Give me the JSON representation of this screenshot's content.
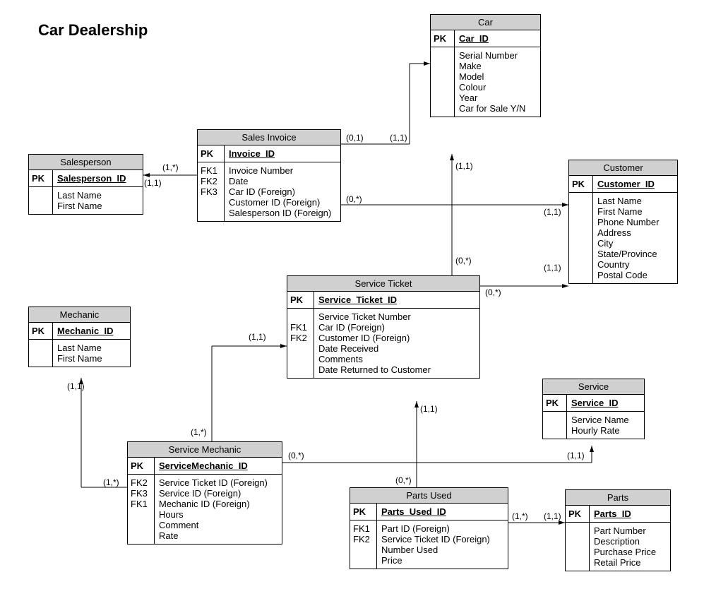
{
  "title": "Car Dealership",
  "entities": {
    "salesperson": {
      "name": "Salesperson",
      "pk_key": "PK",
      "pk_val": "Salesperson_ID",
      "fkeys": [],
      "attrs": [
        "Last Name",
        "First Name"
      ]
    },
    "salesinvoice": {
      "name": "Sales Invoice",
      "pk_key": "PK",
      "pk_val": "Invoice_ID",
      "fkeys": [
        "",
        "",
        "FK1",
        "FK2",
        "FK3"
      ],
      "attrs": [
        "Invoice Number",
        "Date",
        "Car ID (Foreign)",
        "Customer ID (Foreign)",
        "Salesperson ID (Foreign)"
      ]
    },
    "car": {
      "name": "Car",
      "pk_key": "PK",
      "pk_val": "Car_ID",
      "fkeys": [],
      "attrs": [
        "Serial Number",
        "Make",
        "Model",
        "Colour",
        "Year",
        "Car for Sale Y/N"
      ]
    },
    "customer": {
      "name": "Customer",
      "pk_key": "PK",
      "pk_val": "Customer_ID",
      "fkeys": [],
      "attrs": [
        "Last Name",
        "First Name",
        "Phone Number",
        "Address",
        "City",
        "State/Province",
        "Country",
        "Postal Code"
      ]
    },
    "mechanic": {
      "name": "Mechanic",
      "pk_key": "PK",
      "pk_val": "Mechanic_ID",
      "fkeys": [],
      "attrs": [
        "Last Name",
        "First Name"
      ]
    },
    "serviceticket": {
      "name": "Service Ticket",
      "pk_key": "PK",
      "pk_val": "Service_Ticket_ID",
      "fkeys": [
        "",
        "FK1",
        "FK2",
        "",
        "",
        ""
      ],
      "attrs": [
        "Service Ticket Number",
        "Car ID (Foreign)",
        "Customer ID (Foreign)",
        "Date Received",
        "Comments",
        "Date Returned to Customer"
      ]
    },
    "service": {
      "name": "Service",
      "pk_key": "PK",
      "pk_val": "Service_ID",
      "fkeys": [],
      "attrs": [
        "Service Name",
        "Hourly Rate"
      ]
    },
    "servicemechanic": {
      "name": "Service Mechanic",
      "pk_key": "PK",
      "pk_val": "ServiceMechanic_ID",
      "fkeys": [
        "FK2",
        "FK3",
        "FK1",
        "",
        "",
        ""
      ],
      "attrs": [
        "Service Ticket ID (Foreign)",
        "Service ID (Foreign)",
        "Mechanic ID (Foreign)",
        "Hours",
        "Comment",
        "Rate"
      ]
    },
    "partsused": {
      "name": "Parts Used",
      "pk_key": "PK",
      "pk_val": "Parts_Used_ID",
      "fkeys": [
        "FK1",
        "FK2",
        "",
        ""
      ],
      "attrs": [
        "Part ID (Foreign)",
        "Service Ticket ID (Foreign)",
        "Number Used",
        "Price"
      ]
    },
    "parts": {
      "name": "Parts",
      "pk_key": "PK",
      "pk_val": "Parts_ID",
      "fkeys": [],
      "attrs": [
        "Part Number",
        "Description",
        "Purchase Price",
        "Retail Price"
      ]
    }
  },
  "cards": {
    "si_sp_a": "(1,*)",
    "si_sp_b": "(1,1)",
    "si_car_a": "(0,1)",
    "si_car_b": "(1,1)",
    "si_cust_a": "(0,*)",
    "si_cust_b": "(1,1)",
    "car_st": "(1,1)",
    "st_car": "(0,*)",
    "st_cust_a": "(0,*)",
    "st_cust_b": "(1,1)",
    "sm_st_a": "(1,*)",
    "sm_st_b": "(1,1)",
    "sm_mech_a": "(1,*)",
    "sm_mech_b": "(1,1)",
    "sm_svc_a": "(0,*)",
    "sm_svc_b": "(1,1)",
    "pu_st_a": "(0,*)",
    "pu_st_b": "(1,1)",
    "pu_p_a": "(1,*)",
    "pu_p_b": "(1,1)"
  }
}
